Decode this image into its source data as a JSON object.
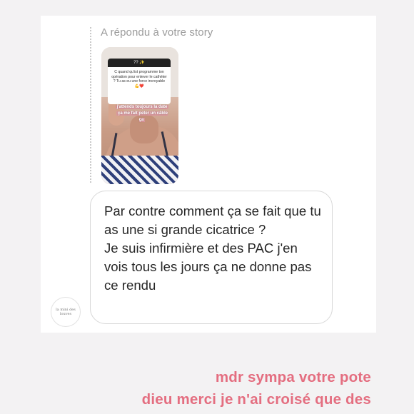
{
  "reply_label": "A répondu à votre story",
  "story": {
    "question_header": "?? ✨",
    "question_text": "C quand qu'ist programme ton opération pour enlever le cathéter ? Tu as eu une force incroyable 💪❤️",
    "answer_line_1": "j'attends toujours la date",
    "answer_line_2": "ça me fait peter un câble ça"
  },
  "message": {
    "paragraph_1": "Par contre comment ça se fait que tu as une si grande cicatrice ?",
    "paragraph_2": "Je suis infirmière et des PAC j'en vois tous les jours ça ne donne pas ce rendu"
  },
  "avatar": {
    "icon": "profile-avatar-logo",
    "text": "la mini des louves"
  },
  "overlay": {
    "line_1": "mdr sympa votre pote",
    "line_2": "dieu merci je n'ai croisé que des",
    "color": "#e46e80"
  }
}
